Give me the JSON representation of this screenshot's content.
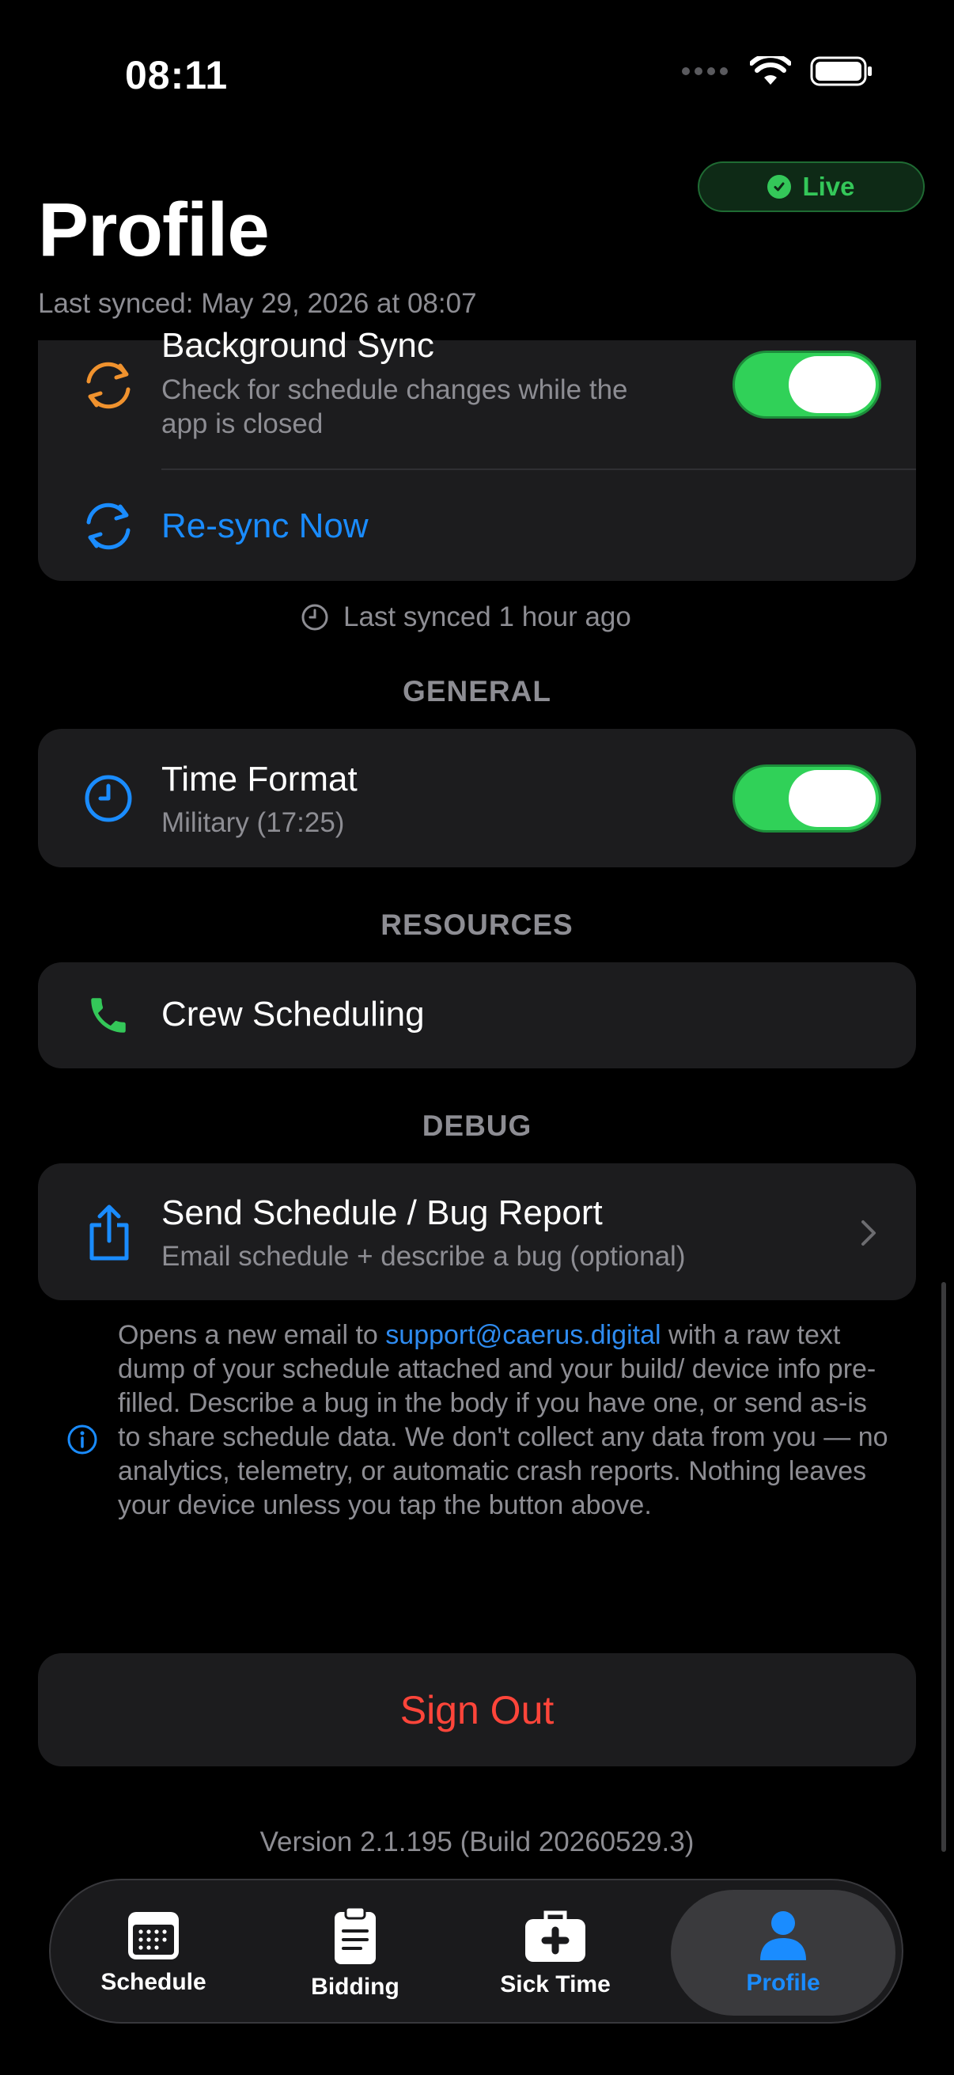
{
  "status_bar": {
    "time": "08:11"
  },
  "header": {
    "title": "Profile",
    "last_synced": "Last synced: May 29, 2026 at 08:07",
    "live_badge": "Live"
  },
  "sync_card": {
    "background_sync": {
      "title": "Background Sync",
      "subtitle_line1": "Check for schedule changes while the",
      "subtitle_line2": "app is closed",
      "enabled": true
    },
    "resync_label": "Re-sync Now"
  },
  "sync_note": "Last synced 1 hour ago",
  "sections": {
    "general": "GENERAL",
    "resources": "RESOURCES",
    "debug": "DEBUG"
  },
  "general": {
    "time_format_title": "Time Format",
    "time_format_value": "Military (17:25)",
    "enabled": true
  },
  "resources": {
    "crew_scheduling": "Crew Scheduling"
  },
  "debug": {
    "report_title": "Send Schedule / Bug Report",
    "report_subtitle": "Email schedule + describe a bug (optional)",
    "info_prefix": "Opens a new email to ",
    "info_email": "support@caerus.digital",
    "info_suffix": " with a raw text dump of your schedule attached and your build/ device info pre-filled. Describe a bug in the body if you have one, or send as-is to share schedule data. We don't collect any data from you — no analytics, telemetry, or automatic crash reports. Nothing leaves your device unless you tap the button above."
  },
  "sign_out": "Sign Out",
  "version": "Version 2.1.195 (Build 20260529.3)",
  "tabs": [
    {
      "label": "Schedule",
      "icon": "calendar-icon",
      "active": false
    },
    {
      "label": "Bidding",
      "icon": "clipboard-icon",
      "active": false
    },
    {
      "label": "Sick Time",
      "icon": "medical-kit-icon",
      "active": false
    },
    {
      "label": "Profile",
      "icon": "person-icon",
      "active": true
    }
  ],
  "colors": {
    "accent_blue": "#1a8cff",
    "green": "#30d158",
    "orange": "#f0922e",
    "red": "#ff453a",
    "card": "#1c1c1e"
  }
}
